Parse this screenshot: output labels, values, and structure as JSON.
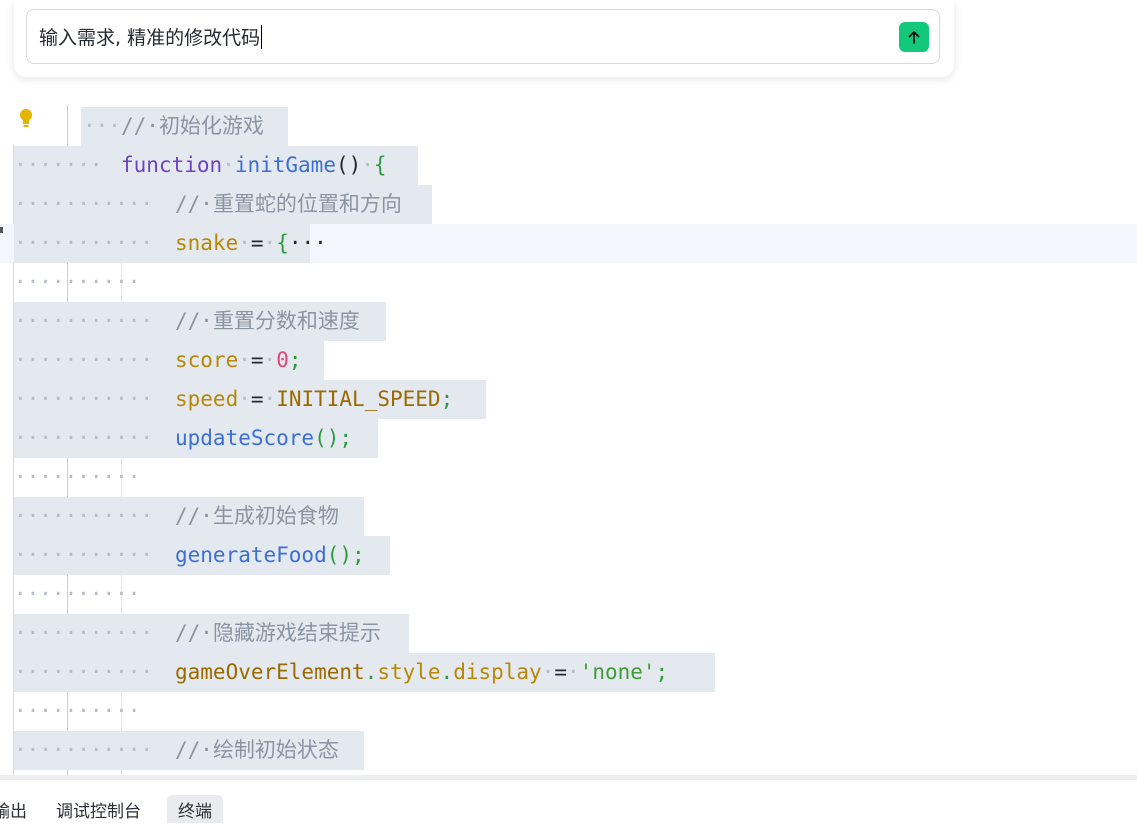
{
  "prompt": {
    "text": "输入需求, 精准的修改代码"
  },
  "editor": {
    "lines": [
      {
        "comment": "初始化游戏"
      },
      {
        "kw": "function",
        "name": "initGame",
        "rest": "()",
        "brace": "{"
      },
      {
        "comment": "重置蛇的位置和方向"
      },
      {
        "var": "snake",
        "op": "=",
        "brace": "{",
        "ellipsis": "···"
      },
      {},
      {
        "comment": "重置分数和速度"
      },
      {
        "var": "score",
        "op": "=",
        "num": "0",
        "semi": ";"
      },
      {
        "var": "speed",
        "op": "=",
        "const": "INITIAL_SPEED",
        "semi": ";"
      },
      {
        "fn": "updateScore",
        "rest": "();"
      },
      {},
      {
        "comment": "生成初始食物"
      },
      {
        "fn": "generateFood",
        "rest": "();"
      },
      {},
      {
        "comment": "隐藏游戏结束提示"
      },
      {
        "obj": "gameOverElement",
        "p1": "style",
        "p2": "display",
        "op": "=",
        "str": "'none'",
        "semi": ";"
      },
      {},
      {
        "comment": "绘制初始状态"
      }
    ]
  },
  "panel": {
    "tabs": [
      "输出",
      "调试控制台",
      "终端"
    ],
    "active_tab": "终端"
  }
}
